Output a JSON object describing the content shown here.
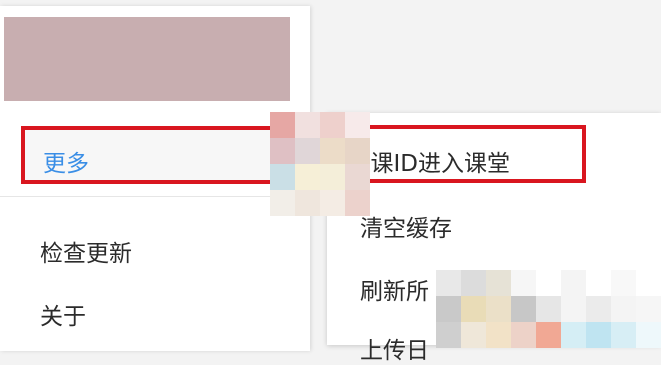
{
  "menu": {
    "more_label": "更多",
    "items": [
      "检查更新",
      "关于"
    ]
  },
  "submenu": {
    "items": [
      "输入课ID进入课堂",
      "清空缓存",
      "刷新所有",
      "上传日志"
    ],
    "shown": [
      "ⅱ课ID进入课堂",
      "清空缓存",
      "刷新所",
      "上传日"
    ]
  },
  "colors": {
    "highlight_border": "#d9161f",
    "more_text": "#3a8ee6",
    "banner": "#c8aeb0"
  }
}
